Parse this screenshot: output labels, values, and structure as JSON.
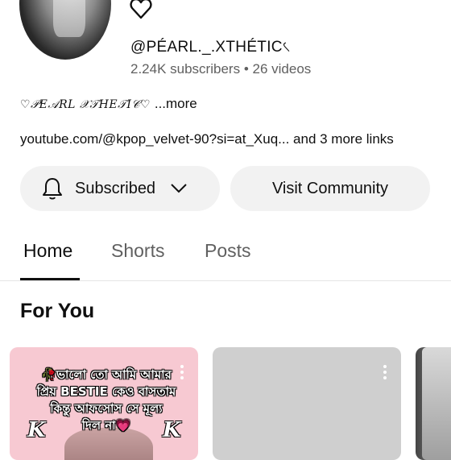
{
  "channel": {
    "name_icon": "heart-outline-icon",
    "name": "@PÉARL._.XTHÉTIC৻",
    "subscribers": "2.24K subscribers",
    "separator": "•",
    "videos": "26 videos",
    "description": "♡𝒫𝐸𝒜𝑅𝐿 𝒳𝒯𝐻𝐸𝒯𝐼𝒞♡",
    "more_label": "...more",
    "links": "youtube.com/@kpop_velvet-90?si=at_Xuq... and 3 more links"
  },
  "actions": {
    "subscribed_label": "Subscribed",
    "bell_icon": "bell-icon",
    "chevron_icon": "chevron-down-icon",
    "community_label": "Visit Community"
  },
  "tabs": [
    {
      "label": "Home",
      "active": true
    },
    {
      "label": "Shorts",
      "active": false
    },
    {
      "label": "Posts",
      "active": false
    }
  ],
  "section": {
    "title": "For You"
  },
  "cards": [
    {
      "overlay_line1": "🥀ভালো তো আমি আমার",
      "overlay_line2": "প্রিয় BESTIE কেও বাসতাম",
      "overlay_line3": "কিন্তু আফসোস সে মূল্য",
      "overlay_line4": "দিল না",
      "heart": "💗",
      "k_left": "K",
      "k_right": "K"
    },
    {},
    {}
  ],
  "colors": {
    "text_primary": "#0f0f0f",
    "text_secondary": "#606060",
    "pill_bg": "#f2f2f2",
    "card1_bg": "#f7c9d2"
  }
}
